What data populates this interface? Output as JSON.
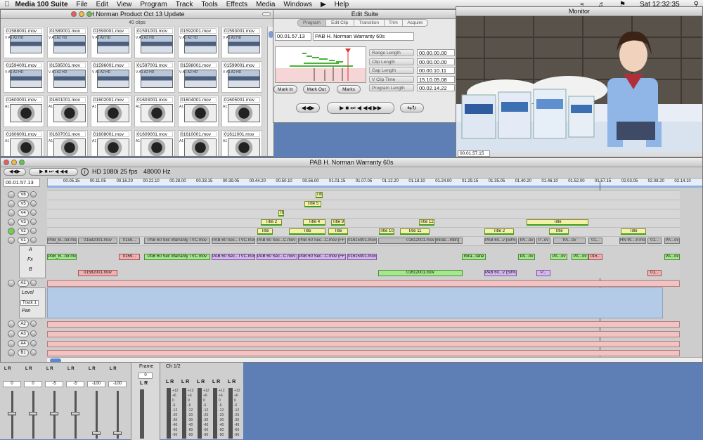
{
  "menubar": {
    "app": "Media 100 Suite",
    "items": [
      "File",
      "Edit",
      "View",
      "Program",
      "Track",
      "Tools",
      "Effects",
      "Media",
      "Windows",
      "Help"
    ],
    "clock": "Sat 12:32:35"
  },
  "bin": {
    "title": "H Norman Product Oct 13 Update",
    "count": "40 clips",
    "clips": [
      {
        "name": "01588001.mov",
        "kind": "vid"
      },
      {
        "name": "01589001.mov",
        "kind": "vid"
      },
      {
        "name": "01590001.mov",
        "kind": "vid"
      },
      {
        "name": "01591001.mov",
        "kind": "vid"
      },
      {
        "name": "01592001.mov",
        "kind": "vid"
      },
      {
        "name": "01593001.mov",
        "kind": "vid"
      },
      {
        "name": "01594001.mov",
        "kind": "vid"
      },
      {
        "name": "01595001.mov",
        "kind": "vid"
      },
      {
        "name": "01596001.mov",
        "kind": "vid"
      },
      {
        "name": "01597001.mov",
        "kind": "vid"
      },
      {
        "name": "01598001.mov",
        "kind": "vid"
      },
      {
        "name": "01599001.mov",
        "kind": "vid"
      },
      {
        "name": "01600001.mov",
        "kind": "aud"
      },
      {
        "name": "01601001.mov",
        "kind": "aud"
      },
      {
        "name": "01602001.mov",
        "kind": "aud"
      },
      {
        "name": "01603001.mov",
        "kind": "aud"
      },
      {
        "name": "01604001.mov",
        "kind": "aud"
      },
      {
        "name": "01605001.mov",
        "kind": "aud"
      },
      {
        "name": "01606001.mov",
        "kind": "aud"
      },
      {
        "name": "01607001.mov",
        "kind": "aud"
      },
      {
        "name": "01608001.mov",
        "kind": "aud"
      },
      {
        "name": "01609001.mov",
        "kind": "aud"
      },
      {
        "name": "01610001.mov",
        "kind": "aud"
      },
      {
        "name": "01611001.mov",
        "kind": "aud"
      }
    ]
  },
  "edit": {
    "title": "Edit Suite",
    "tabs": [
      "Program",
      "Edit Clip",
      "Transition",
      "Trim",
      "Acquire"
    ],
    "timecode": "00.01.57.13",
    "program_name": "PAB H. Norman Warranty 60s",
    "readouts": [
      {
        "label": "Range Length",
        "value": "00.00.00.00"
      },
      {
        "label": "Clip Length",
        "value": "00.00.00.00"
      },
      {
        "label": "Gap Length",
        "value": "00.00.10.11"
      },
      {
        "label": "V Clip Time",
        "value": "15.10.05.08"
      },
      {
        "label": "Program Length",
        "value": "00.02.14.22"
      }
    ],
    "buttons": {
      "mark_in": "Mark In",
      "mark_out": "Mark Out",
      "marks": "Marks"
    }
  },
  "monitor": {
    "title": "Monitor",
    "timecode": "00.01.57.15"
  },
  "timeline": {
    "title": "PAB H. Norman Warranty 60s",
    "format": "HD 1080i 25 fps",
    "rate": "48000 Hz",
    "timecode": "00.01.57.13",
    "ruler": [
      "00.05.15",
      "00.11.05",
      "00.16.20",
      "00.22.10",
      "00.28.00",
      "00.33.15",
      "00.39.05",
      "00.44.20",
      "00.50.10",
      "00.56.00",
      "01.01.15",
      "01.07.05",
      "01.12.20",
      "01.18.10",
      "01.24.00",
      "01.29.15",
      "01.35.05",
      "01.40.20",
      "01.46.10",
      "01.52.00",
      "01.57.15",
      "02.03.05",
      "02.08.20",
      "02.14.10"
    ],
    "tracks": [
      "V6",
      "V5",
      "V4",
      "V3",
      "V2",
      "V1"
    ],
    "labels": {
      "a": "A",
      "fx": "Fx",
      "b": "B",
      "level": "Level",
      "track1": "Track 1",
      "pan": "Pan",
      "lr": "L R"
    },
    "audio_tracks": [
      "A1",
      "A2",
      "A3",
      "A4",
      "B1"
    ],
    "titles": [
      {
        "text": "Title 6",
        "track": "V6"
      },
      {
        "text": "Title 5",
        "track": "V5"
      },
      {
        "text": "Title",
        "track": "V4"
      },
      {
        "text": "Title 2",
        "track": "V3"
      },
      {
        "text": "Title 4",
        "track": "V3"
      },
      {
        "text": "Title 9",
        "track": "V3"
      },
      {
        "text": "Title 12",
        "track": "V3"
      },
      {
        "text": "Title",
        "track": "V3"
      },
      {
        "text": "Title",
        "track": "V2"
      },
      {
        "text": "Title",
        "track": "V2"
      },
      {
        "text": "Title",
        "track": "V2"
      },
      {
        "text": "Title 10",
        "track": "V2"
      },
      {
        "text": "Title 11",
        "track": "V2"
      },
      {
        "text": "Title 2",
        "track": "V2"
      },
      {
        "text": "Title",
        "track": "V2"
      },
      {
        "text": "Title",
        "track": "V2"
      }
    ],
    "v1_clips": [
      "PAB_B...tor.mov",
      "01582001.mov",
      "0159...",
      "PAB 60 Sec Warranty TVC.mov",
      "PAB 60 Sec...TVC.mov",
      "PAB 60 Sec...C.mov (FF)",
      "PAB 60 Sec...C.mov (FF)",
      "01615001.mov",
      "01612001.mov",
      "mirac...mbrane",
      "PAB 60...v (59%)",
      "PA...ov",
      "P...ov",
      "PA...ov",
      "01...",
      "HN W....P.mov",
      "01...",
      "PA...ov"
    ],
    "a_clips": [
      "PAB_B...tor.mov",
      "0159...",
      "PAB 60 Sec Warranty TVC.mov",
      "PAB 60 Sec...TVC.mov",
      "PAB 60 Sec...C.mov (FF)",
      "PAB 60 Sec...C.mov (FF)",
      "01615001.mov",
      "mira...rane",
      "PA...ov",
      "PA...ov",
      "PA...ov",
      "015...",
      "PA...ov"
    ],
    "b_clips": [
      "01582001.mov",
      "01612001.mov",
      "PAB 60...v (59%)",
      "P...",
      "01..."
    ]
  },
  "mixer": {
    "levels": [
      "0",
      "0",
      "-5",
      "-5",
      "-100",
      "-100"
    ],
    "frame_label": "Frame",
    "frame_val": "0",
    "ch_label": "Ch 1/2",
    "scale": [
      "+12",
      "+6",
      "0",
      "-6",
      "-12",
      "-20",
      "-30",
      "-40",
      "-60",
      "-90"
    ]
  },
  "colors": {
    "desktop": "#5e7fb6",
    "title_clip": "#f3f2a6",
    "audio": "#f3c3c3",
    "green_clip": "#a5e78e",
    "pink_clip": "#f2b0b0"
  }
}
